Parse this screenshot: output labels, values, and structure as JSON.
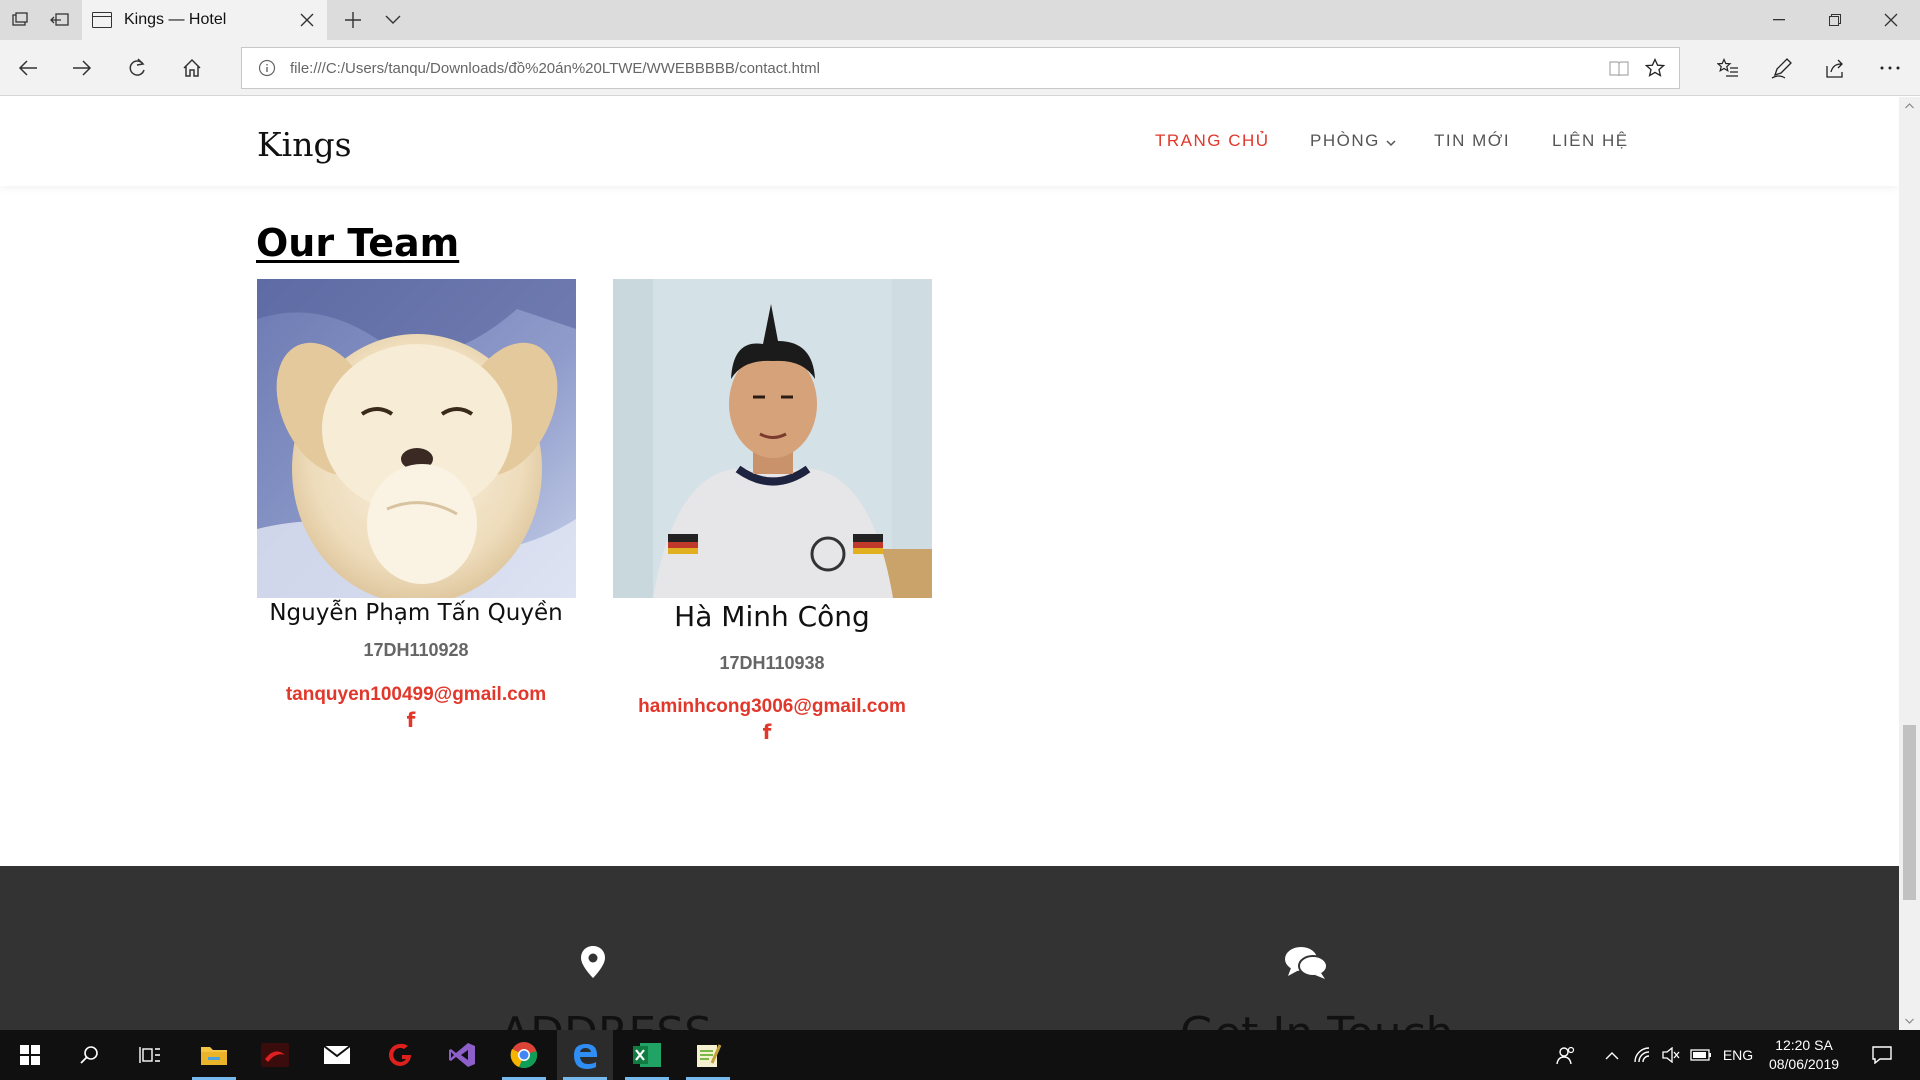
{
  "browser": {
    "tab_title": "Kings — Hotel",
    "url": "file:///C:/Users/tanqu/Downloads/đồ%20án%20LTWE/WWEBBBBB/contact.html"
  },
  "site": {
    "brand": "Kings",
    "menu": [
      {
        "label": "TRANG CHỦ",
        "active": true
      },
      {
        "label": "PHÒNG",
        "has_dropdown": true
      },
      {
        "label": "TIN MỚI"
      },
      {
        "label": "LIÊN HỆ"
      }
    ],
    "team_title": "Our Team",
    "members": [
      {
        "name": "Nguyễn Phạm Tấn Quyền",
        "student_id": "17DH110928",
        "email": "tanquyen100499@gmail.com",
        "facebook_icon": "f",
        "photo": "puppy-photo"
      },
      {
        "name": "Hà Minh Công",
        "student_id": "17DH110938",
        "email": "haminhcong3006@gmail.com",
        "facebook_icon": "f",
        "photo": "portrait-photo"
      }
    ],
    "footer": {
      "address_heading": "ADDRESS",
      "contact_heading": "Get In Touch"
    }
  },
  "taskbar": {
    "language": "ENG",
    "time": "12:20 SA",
    "date": "08/06/2019"
  },
  "colors": {
    "accent": "#e2372b",
    "footer_bg": "#333333",
    "taskbar_bg": "#101010"
  }
}
